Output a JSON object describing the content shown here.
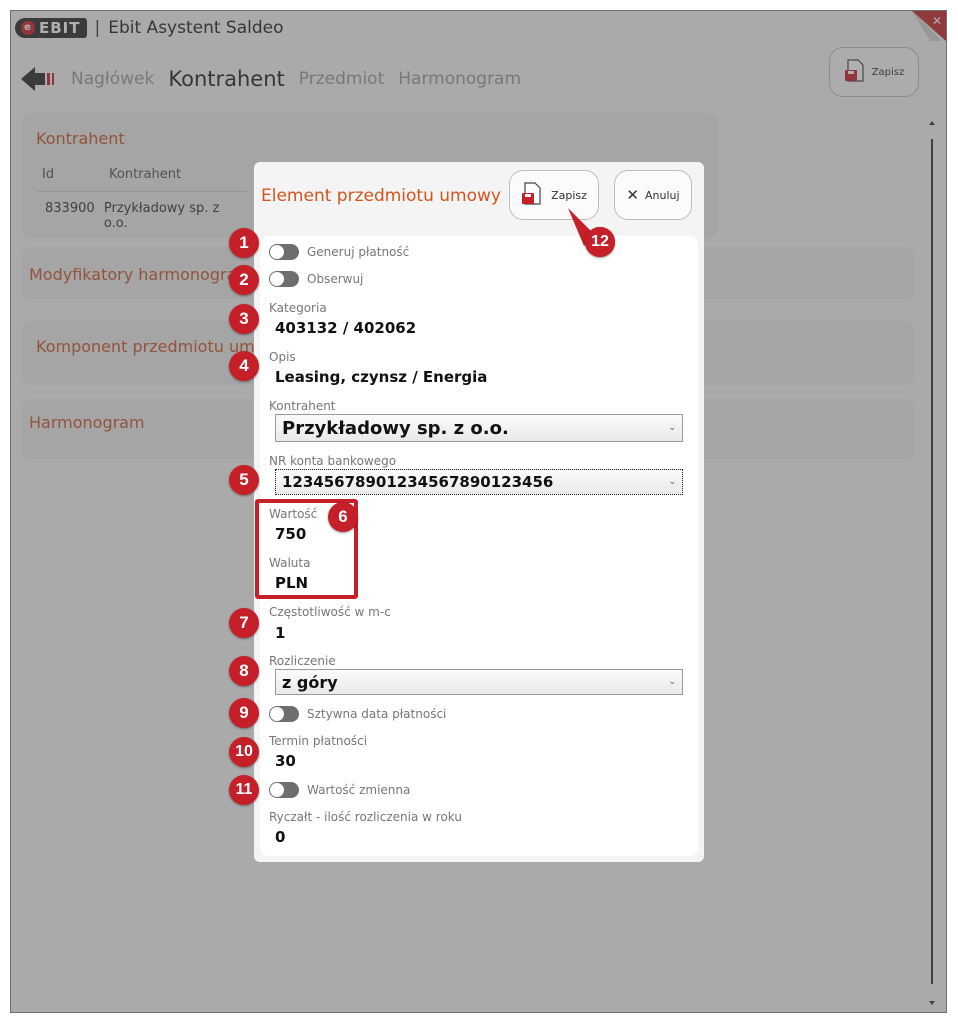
{
  "app": {
    "logo": "EBIT",
    "separator": "|",
    "title": "Ebit Asystent Saldeo"
  },
  "nav": {
    "tabs": [
      "Nagłówek",
      "Kontrahent",
      "Przedmiot",
      "Harmonogram"
    ],
    "active_tab": "Kontrahent",
    "save_label": "Zapisz"
  },
  "background": {
    "kontrahent_heading": "Kontrahent",
    "table_headers": [
      "Id",
      "Kontrahent"
    ],
    "table_row": [
      "833900",
      "Przykładowy sp. z o.o."
    ],
    "modyfikatory_heading": "Modyfikatory harmonogra",
    "komponent_heading": "Komponent przedmiotu um",
    "harmonogram_heading": "Harmonogram"
  },
  "modal": {
    "title": "Element przedmiotu umowy",
    "save_label": "Zapisz",
    "cancel_label": "Anuluj",
    "generuj_platnosc": "Generuj płatność",
    "obserwuj": "Obserwuj",
    "kategoria_label": "Kategoria",
    "kategoria_value": "403132 / 402062",
    "opis_label": "Opis",
    "opis_value": "Leasing, czynsz / Energia",
    "kontrahent_label": "Kontrahent",
    "kontrahent_value": "Przykładowy sp. z o.o.",
    "konto_label": "NR konta bankowego",
    "konto_value": "12345678901234567890123456",
    "wartosc_label": "Wartość",
    "wartosc_value": "750",
    "waluta_label": "Waluta",
    "waluta_value": "PLN",
    "czestotliwosc_label": "Częstotliwość w m-c",
    "czestotliwosc_value": "1",
    "rozliczenie_label": "Rozliczenie",
    "rozliczenie_value": "z góry",
    "sztywna_data": "Sztywna data płatności",
    "termin_label": "Termin płatności",
    "termin_value": "30",
    "wartosc_zmienna": "Wartość zmienna",
    "ryczalt_label": "Ryczałt - ilość rozliczenia w roku",
    "ryczalt_value": "0"
  },
  "badges": [
    "1",
    "2",
    "3",
    "4",
    "5",
    "6",
    "7",
    "8",
    "9",
    "10",
    "11",
    "12"
  ],
  "colors": {
    "accent": "#d4531d",
    "badge": "#c51f2a"
  }
}
